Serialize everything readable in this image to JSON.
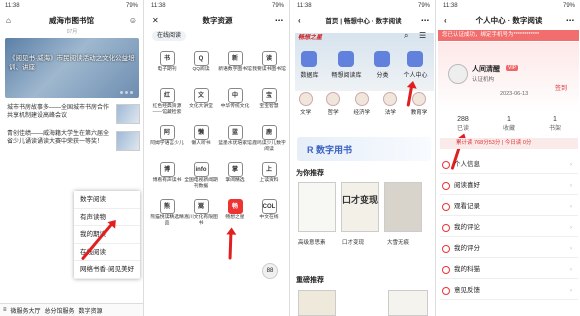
{
  "status": {
    "time": "11:38",
    "right": "79%"
  },
  "s1": {
    "title": "威海市图书馆",
    "banner_date": "07月",
    "banner_text": "《阅见书·威海》市民阅读活动之文化公益培训、讲座",
    "news1": "城市书房故事多——全国城市书房合作共享机制建设高峰会议",
    "news2": "青创佳绩——威海籍大学生在第六届全省少儿诵读诵读大赛中荣获一等奖！",
    "menu": [
      "数字阅读",
      "有声读物",
      "我的期读",
      "在线阅读",
      "网络书香·阅见美好"
    ],
    "tabs": [
      "≡",
      "微服务大厅",
      "总分馆服务",
      "数字资源"
    ]
  },
  "s2": {
    "title": "数字资源",
    "pill": "在线阅读",
    "items": [
      {
        "l": "电子期刊",
        "i": "书"
      },
      {
        "l": "QQ阅读",
        "i": "Q"
      },
      {
        "l": "新语数字图书馆",
        "i": "新"
      },
      {
        "l": "我要读书图书馆",
        "i": "读"
      },
      {
        "l": "红色经典资源——馆藏检索",
        "i": "红"
      },
      {
        "l": "文化大讲堂",
        "i": "文"
      },
      {
        "l": "中华传统文化",
        "i": "中"
      },
      {
        "l": "宝宝智慧",
        "i": "宝"
      },
      {
        "l": "阿姆学语言少儿",
        "i": "阿"
      },
      {
        "l": "懒人听书",
        "i": "懒"
      },
      {
        "l": "蓝墨水优培家馆",
        "i": "蓝"
      },
      {
        "l": "鹿鸣读少儿数字阅读",
        "i": "鹿"
      },
      {
        "l": "博看有声读书",
        "i": "博"
      },
      {
        "l": "全国电视新闻期刊数据",
        "i": "info"
      },
      {
        "l": "掌阅精选",
        "i": "掌"
      },
      {
        "l": "上读资料",
        "i": "上"
      },
      {
        "l": "熊猫悦读精选精品",
        "i": "熊"
      },
      {
        "l": "嵩川文化有限图书",
        "i": "嵩"
      },
      {
        "l": "畅想之星",
        "i": "畅"
      },
      {
        "l": "中文在线",
        "i": "COL"
      }
    ],
    "fab": "88"
  },
  "s3": {
    "title": "首页 | 畅想中心 · 数字阅读",
    "logo": "畅想之星",
    "big": [
      "数据库",
      "畅想阅读库",
      "分类",
      "个人中心"
    ],
    "five": [
      "文学",
      "哲学",
      "经济学",
      "法学",
      "教育学"
    ],
    "rbanner": "R 数字用书",
    "rec": "为你推荐",
    "books": [
      "高级意思素",
      "口才变现",
      "大雪无痕"
    ],
    "cover2": "口才变现",
    "focus": "重磅推荐"
  },
  "s4": {
    "title": "个人中心 · 数字阅读",
    "notice": "您已认证成功，绑定手机号为************",
    "name": "人间清醒",
    "badge": "VIP",
    "uid": "认证机构",
    "date": "2023-06-13",
    "sign": "签到",
    "stats": [
      {
        "n": "288",
        "l": "已读"
      },
      {
        "n": "1",
        "l": "收藏"
      },
      {
        "n": "1",
        "l": "书架"
      }
    ],
    "vip": "累计读 768分53分 | 今日读 0分",
    "rows": [
      "个人信息",
      "阅读喜好",
      "观看记录",
      "我的评论",
      "我的评分",
      "我的科猫",
      "意见反馈"
    ]
  }
}
